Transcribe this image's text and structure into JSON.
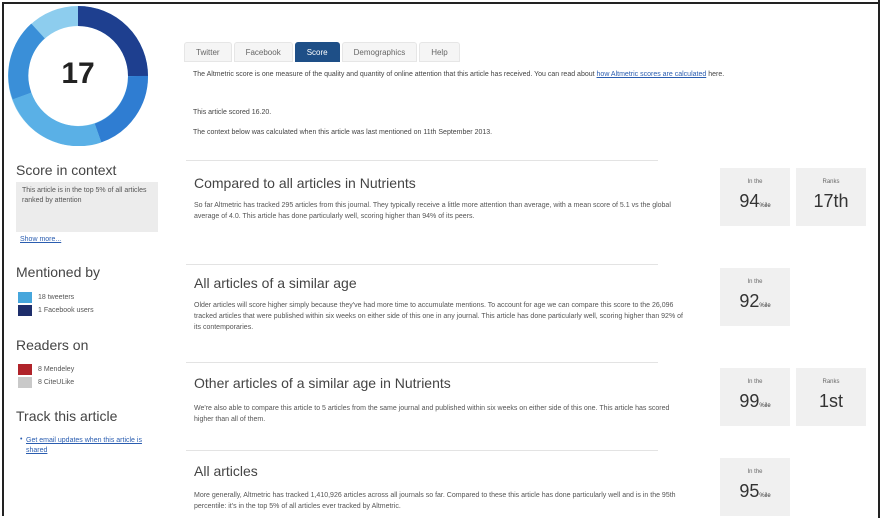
{
  "score": {
    "value": "17",
    "ring_colors": [
      "#1e3f8f",
      "#2f7dd2",
      "#5ab0e6",
      "#8dcdee"
    ]
  },
  "sidebar": {
    "context_heading": "Score in context",
    "context_text": "This article is in the top 5% of all articles ranked by attention",
    "show_more": "Show more...",
    "mentioned_heading": "Mentioned by",
    "mentions": [
      {
        "label": "18 tweeters",
        "color": "#46a6dc"
      },
      {
        "label": "1 Facebook users",
        "color": "#1e2e6b"
      }
    ],
    "readers_heading": "Readers on",
    "readers": [
      {
        "label": "8 Mendeley",
        "color": "#b0232a"
      },
      {
        "label": "8 CiteULike",
        "color": "#c9c9c9"
      }
    ],
    "track_heading": "Track this article",
    "track_link": "Get email updates when this article is shared"
  },
  "tabs": [
    "Twitter",
    "Facebook",
    "Score",
    "Demographics",
    "Help"
  ],
  "active_tab": "Score",
  "intro": {
    "text": "The Altmetric score is one measure of the quality and quantity of online attention that this article has received. You can read about",
    "link": "how Altmetric scores are calculated",
    "text_after": "here.",
    "scored": "This article scored 16.20.",
    "calc": "The context below was calculated when this article was last mentioned on 11th September 2013."
  },
  "sections": [
    {
      "title": "Compared to all articles in Nutrients",
      "body": "So far Altmetric has tracked 295 articles from this journal. They typically receive a little more attention than average, with a mean score of 5.1 vs the global average of 4.0. This article has done particularly well, scoring higher than 94% of its peers.",
      "stats": [
        {
          "label": "In the",
          "value": "94",
          "suffix": "%ile"
        },
        {
          "label": "Ranks",
          "value": "17th",
          "suffix": ""
        }
      ]
    },
    {
      "title": "All articles of a similar age",
      "body": "Older articles will score higher simply because they've had more time to accumulate mentions. To account for age we can compare this score to the 26,096 tracked articles that were published within six weeks on either side of this one in any journal. This article has done particularly well, scoring higher than 92% of its contemporaries.",
      "stats": [
        {
          "label": "In the",
          "value": "92",
          "suffix": "%ile"
        }
      ]
    },
    {
      "title": "Other articles of a similar age in Nutrients",
      "body": "We're also able to compare this article to 5 articles from the same journal and published within six weeks on either side of this one. This article has scored higher than all of them.",
      "stats": [
        {
          "label": "In the",
          "value": "99",
          "suffix": "%ile"
        },
        {
          "label": "Ranks",
          "value": "1st",
          "suffix": ""
        }
      ]
    },
    {
      "title": "All articles",
      "body": "More generally, Altmetric has tracked 1,410,926 articles across all journals so far. Compared to these this article has done particularly well and is in the 95th percentile: it's in the top 5% of all articles ever tracked by Altmetric.",
      "stats": [
        {
          "label": "In the",
          "value": "95",
          "suffix": "%ile"
        }
      ]
    }
  ]
}
